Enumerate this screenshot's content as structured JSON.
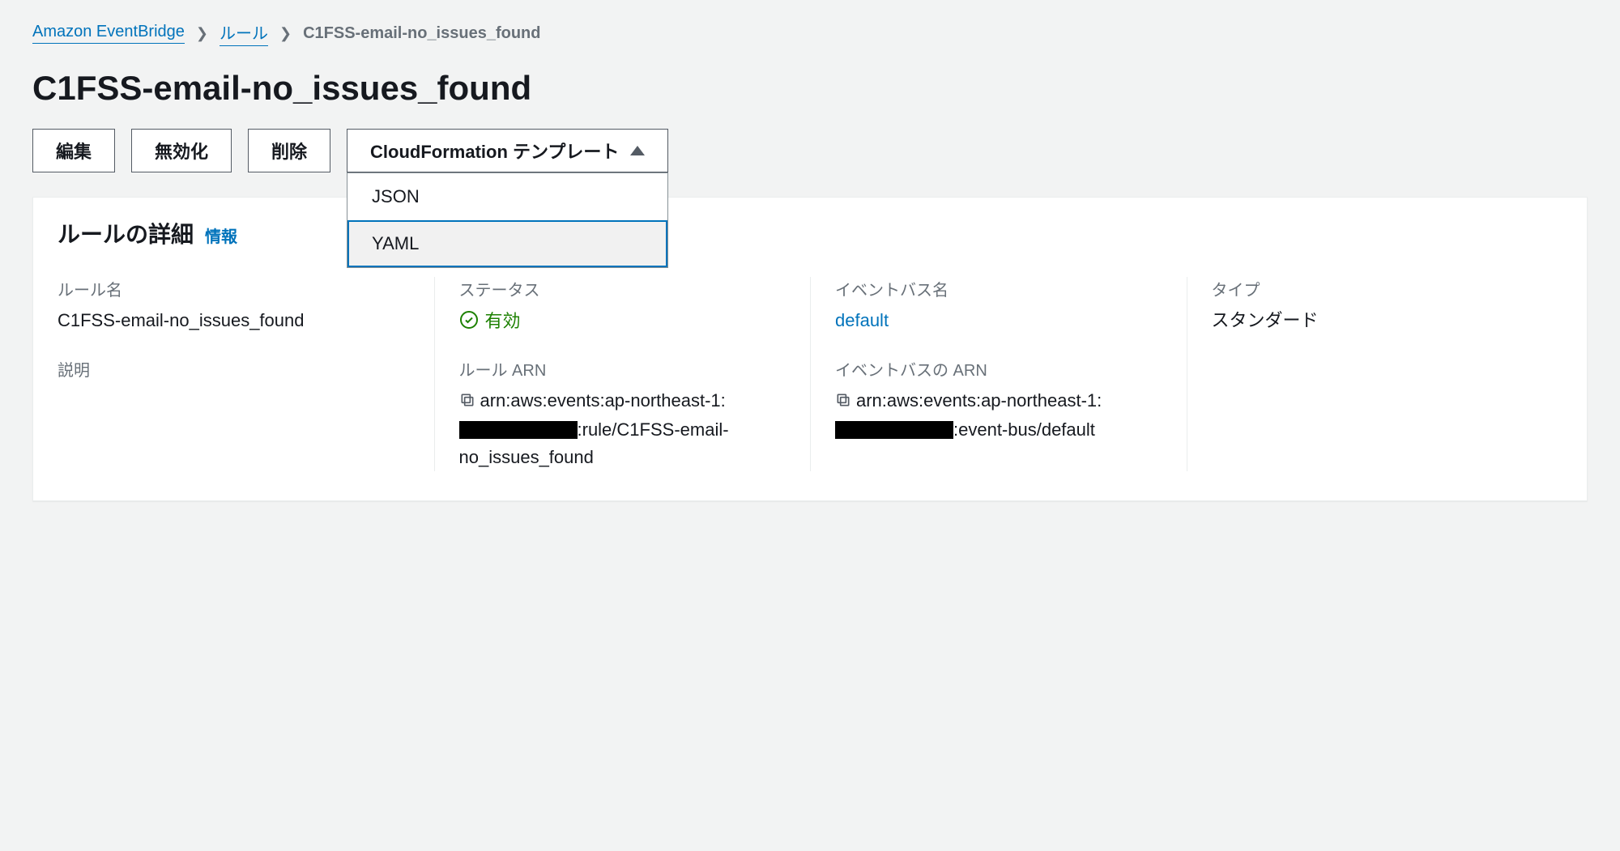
{
  "breadcrumb": {
    "root": "Amazon EventBridge",
    "rules": "ルール",
    "current": "C1FSS-email-no_issues_found"
  },
  "page_title": "C1FSS-email-no_issues_found",
  "actions": {
    "edit": "編集",
    "disable": "無効化",
    "delete": "削除",
    "cfn_template": "CloudFormation テンプレート",
    "dd_json": "JSON",
    "dd_yaml": "YAML"
  },
  "panel": {
    "header": "ルールの詳細",
    "info": "情報"
  },
  "details": {
    "rule_name_label": "ルール名",
    "rule_name_value": "C1FSS-email-no_issues_found",
    "description_label": "説明",
    "description_value": "",
    "status_label": "ステータス",
    "status_value": "有効",
    "rule_arn_label": "ルール ARN",
    "rule_arn_prefix": "arn:aws:events:ap-northeast-1:",
    "rule_arn_suffix": ":rule/C1FSS-email-no_issues_found",
    "bus_name_label": "イベントバス名",
    "bus_name_value": "default",
    "bus_arn_label": "イベントバスの ARN",
    "bus_arn_prefix": "arn:aws:events:ap-northeast-1:",
    "bus_arn_suffix": ":event-bus/default",
    "type_label": "タイプ",
    "type_value": "スタンダード"
  }
}
